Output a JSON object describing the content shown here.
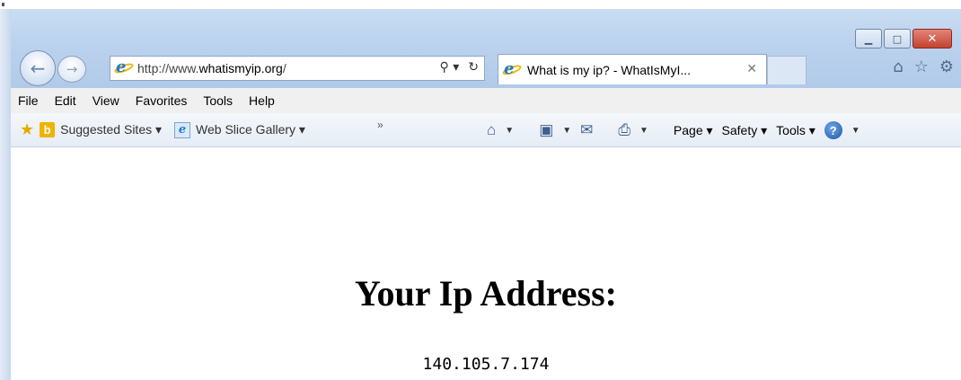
{
  "window": {
    "controls": {
      "minimize": "▁",
      "maximize": "□",
      "close": "✕"
    }
  },
  "nav": {
    "back_icon": "←",
    "forward_icon": "→",
    "address": {
      "prefix": "http://www.",
      "domain": "whatismyip.org",
      "suffix": "/"
    },
    "search_icon": "⚲ ▾",
    "refresh_icon": "↻"
  },
  "tab": {
    "title": "What is my ip? - WhatIsMyI...",
    "close": "✕"
  },
  "toolbar_right": {
    "home": "⌂",
    "favorites": "☆",
    "tools": "⚙"
  },
  "menu": {
    "items": [
      "File",
      "Edit",
      "View",
      "Favorites",
      "Tools",
      "Help"
    ]
  },
  "favorites_bar": {
    "suggested_sites": "Suggested Sites ▾",
    "web_slice_gallery": "Web Slice Gallery ▾",
    "overflow": "»",
    "commands": {
      "page": "Page ▾",
      "safety": "Safety ▾",
      "tools": "Tools ▾",
      "help": "?"
    }
  },
  "page": {
    "heading": "Your Ip Address:",
    "ip": "140.105.7.174"
  }
}
